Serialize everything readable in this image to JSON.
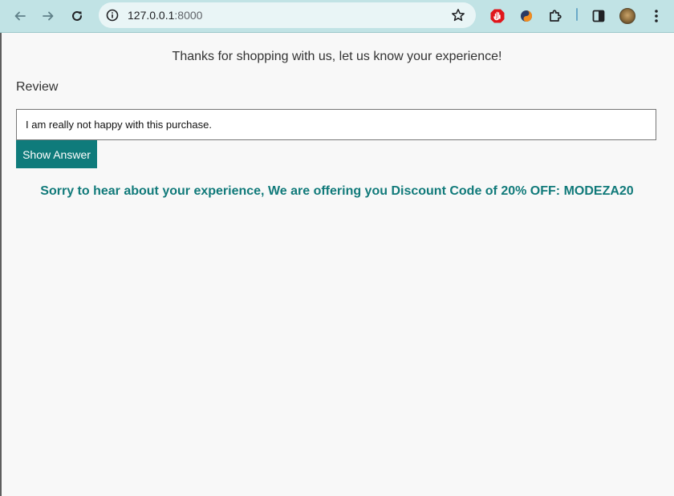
{
  "browser": {
    "url_host": "127.0.0.1",
    "url_port": ":8000",
    "colors": {
      "toolbar": "#c1e3e5",
      "omnibox": "#e9f5f6"
    },
    "icons": [
      "back-arrow-icon",
      "forward-arrow-icon",
      "reload-icon",
      "info-icon",
      "star-icon",
      "adblock-extension-icon",
      "sharp-extension-icon",
      "puzzle-extensions-icon",
      "side-panel-icon",
      "profile-avatar",
      "kebab-menu-icon"
    ]
  },
  "page": {
    "intro_text": "Thanks for shopping with us, let us know your experience!",
    "review_label": "Review",
    "review_value": "I am really not happy with this purchase.",
    "button_label": "Show Answer",
    "result_text": "Sorry to hear about your experience, We are offering you Discount Code of 20% OFF: MODEZA20",
    "colors": {
      "accent": "#0f7b7b",
      "background": "#f8f8f8"
    }
  }
}
